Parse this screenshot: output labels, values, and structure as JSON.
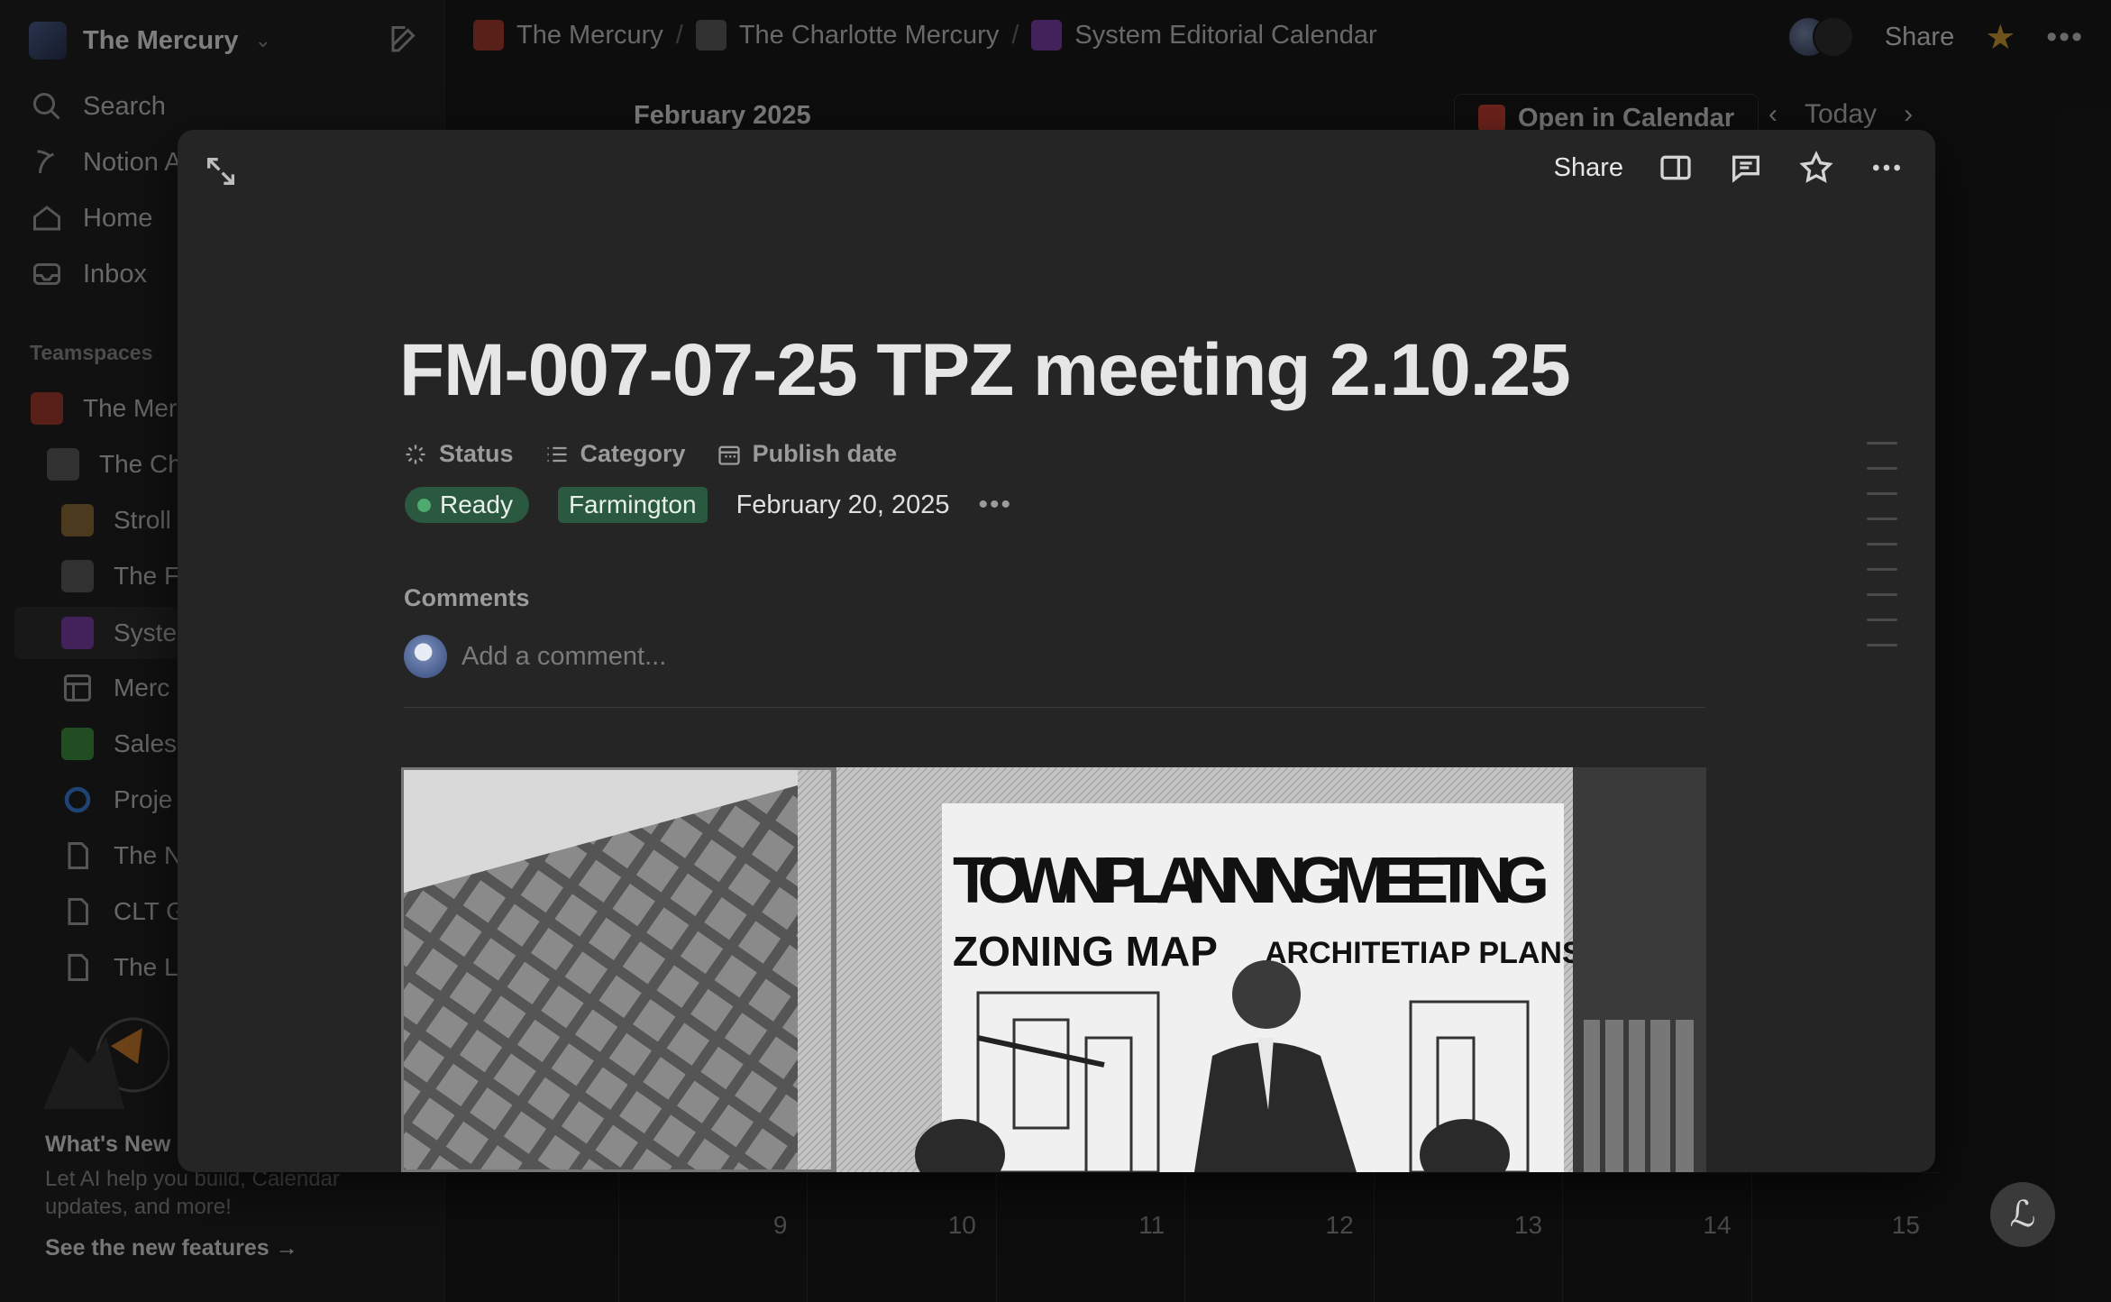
{
  "workspace": {
    "name": "The Mercury"
  },
  "sidebar": {
    "nav": [
      {
        "label": "Search",
        "icon": "search-icon"
      },
      {
        "label": "Notion A",
        "icon": "notion-ai-icon"
      },
      {
        "label": "Home",
        "icon": "home-icon"
      },
      {
        "label": "Inbox",
        "icon": "inbox-icon"
      }
    ],
    "section_title": "Teamspaces",
    "tree": [
      {
        "label": "The Mer"
      },
      {
        "label": "The Ch"
      },
      {
        "label": "Stroll"
      },
      {
        "label": "The F"
      },
      {
        "label": "Syste"
      },
      {
        "label": "Merc"
      },
      {
        "label": "Sales"
      },
      {
        "label": "Proje"
      },
      {
        "label": "The N"
      },
      {
        "label": "CLT G"
      },
      {
        "label": "The L"
      }
    ],
    "whats_new": {
      "title": "What's New",
      "description": "Let AI help you build, Calendar updates, and more!",
      "link": "See the new features"
    }
  },
  "breadcrumb": [
    {
      "label": "The Mercury"
    },
    {
      "label": "The Charlotte Mercury"
    },
    {
      "label": "System Editorial Calendar"
    }
  ],
  "topbar": {
    "share": "Share"
  },
  "calendar": {
    "month": "February 2025",
    "open_label": "Open in Calendar",
    "today": "Today",
    "days": [
      "9",
      "10",
      "11",
      "12",
      "13",
      "14",
      "15"
    ]
  },
  "modal": {
    "share": "Share",
    "title": "FM-007-07-25 TPZ meeting 2.10.25",
    "properties": {
      "status_label": "Status",
      "category_label": "Category",
      "publish_label": "Publish date",
      "status_value": "Ready",
      "category_value": "Farmington",
      "publish_value": "February 20, 2025"
    },
    "comments_label": "Comments",
    "comment_placeholder": "Add a comment...",
    "image": {
      "headline": "TOWN PLANNING MEETING",
      "sub_left": "ZONING MAP",
      "sub_right": "ARCHITEТIAP PLANS"
    }
  },
  "colors": {
    "status_green": "#2b593f",
    "accent_star": "#c99a33",
    "background": "#191919"
  }
}
